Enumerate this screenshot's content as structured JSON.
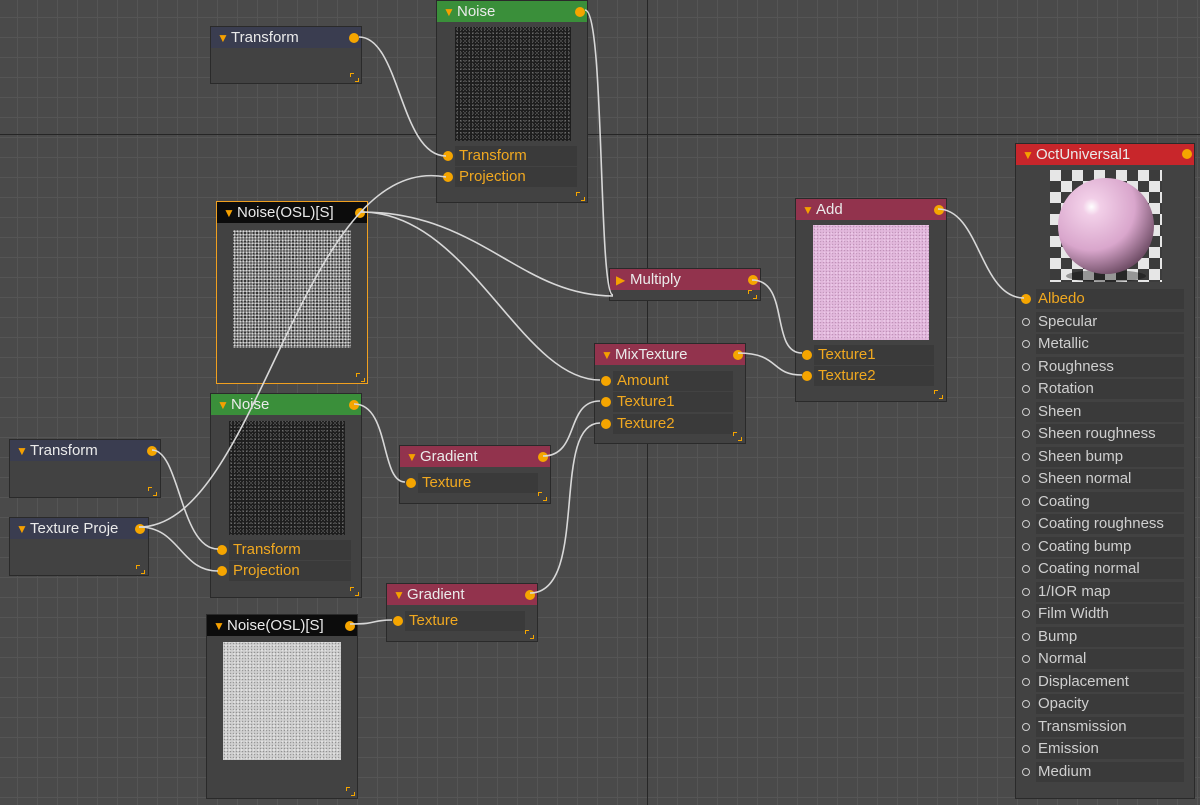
{
  "nodes": {
    "transform_top": {
      "title": "Transform"
    },
    "noise_top": {
      "title": "Noise",
      "pins": [
        "Transform",
        "Projection"
      ]
    },
    "noise_osl_selected": {
      "title": "Noise(OSL)[S]"
    },
    "noise_mid": {
      "title": "Noise",
      "pins": [
        "Transform",
        "Projection"
      ]
    },
    "transform_left": {
      "title": "Transform"
    },
    "texture_proj": {
      "title": "Texture Proje"
    },
    "noise_osl_bottom": {
      "title": "Noise(OSL)[S]"
    },
    "gradient_1": {
      "title": "Gradient",
      "pins": [
        "Texture"
      ]
    },
    "gradient_2": {
      "title": "Gradient",
      "pins": [
        "Texture"
      ]
    },
    "multiply": {
      "title": "Multiply"
    },
    "mixtexture": {
      "title": "MixTexture",
      "pins": [
        "Amount",
        "Texture1",
        "Texture2"
      ]
    },
    "add": {
      "title": "Add",
      "pins": [
        "Texture1",
        "Texture2"
      ]
    },
    "oct_universal": {
      "title": "OctUniversal1",
      "pins": [
        "Albedo",
        "Specular",
        "Metallic",
        "Roughness",
        "Rotation",
        "Sheen",
        "Sheen roughness",
        "Sheen bump",
        "Sheen normal",
        "Coating",
        "Coating roughness",
        "Coating bump",
        "Coating normal",
        "1/IOR map",
        "Film Width",
        "Bump",
        "Normal",
        "Displacement",
        "Opacity",
        "Transmission",
        "Emission",
        "Medium"
      ]
    }
  },
  "colors": {
    "pin": "#f5a500",
    "wire": "#d8d8d8",
    "header_transform": "#3a3d50",
    "header_noise": "#3a8f3a",
    "header_math": "#92334d",
    "header_osl": "#0c0c0c",
    "header_material": "#c8262b",
    "selection": "#f0a020"
  },
  "icons": {
    "collapse": "triangle-down-icon",
    "expand": "triangle-right-icon",
    "resize": "resize-corner-icon"
  }
}
